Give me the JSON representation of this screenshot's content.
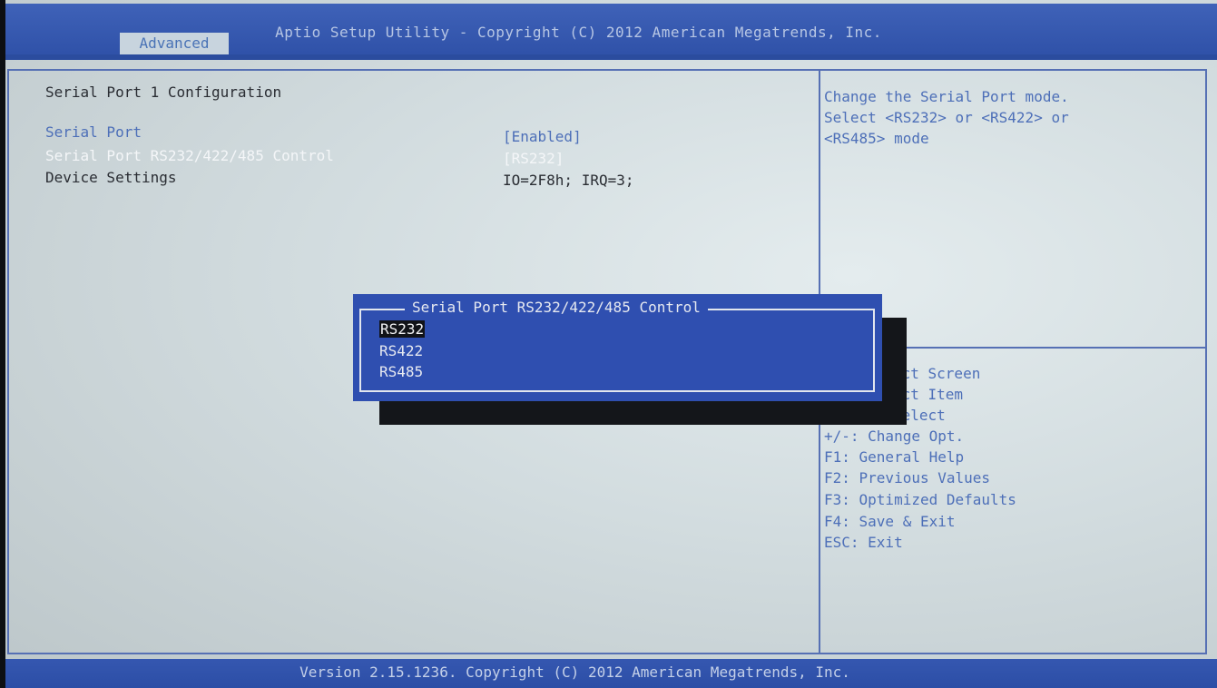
{
  "header": {
    "title": "Aptio Setup Utility - Copyright (C) 2012 American Megatrends, Inc.",
    "tab": "Advanced"
  },
  "main": {
    "section_title": "Serial Port 1 Configuration",
    "settings": [
      {
        "label": "Serial Port",
        "value": "[Enabled]"
      },
      {
        "label": "Serial Port RS232/422/485 Control",
        "value": "[RS232]"
      },
      {
        "label": "Device Settings",
        "value": "IO=2F8h; IRQ=3;"
      }
    ]
  },
  "help": {
    "lines": [
      "Change the Serial Port mode.",
      "Select <RS232> or <RS422> or",
      "<RS485> mode"
    ]
  },
  "keys": [
    "ect Screen",
    "ect Item",
    "Select",
    "+/-: Change Opt.",
    "F1: General Help",
    "F2: Previous Values",
    "F3: Optimized Defaults",
    "F4: Save & Exit",
    "ESC: Exit"
  ],
  "popup": {
    "title": "Serial Port RS232/422/485 Control",
    "options": [
      "RS232",
      "RS422",
      "RS485"
    ],
    "selected": "RS232"
  },
  "footer": {
    "text": "Version 2.15.1236. Copyright (C) 2012 American Megatrends, Inc."
  }
}
